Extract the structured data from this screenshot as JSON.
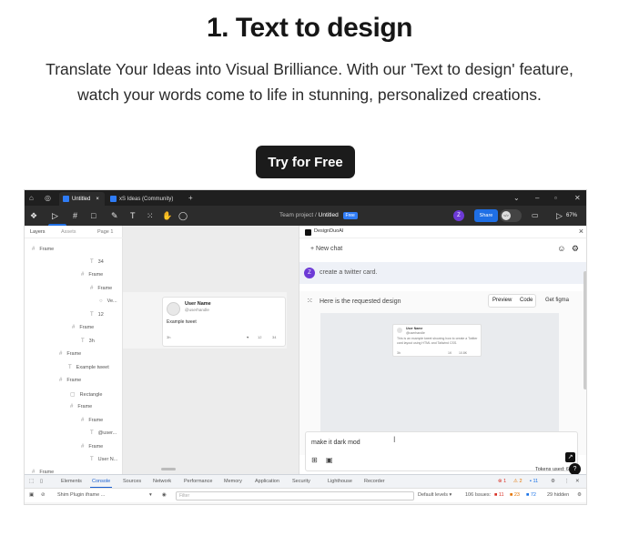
{
  "hero": {
    "title": "1. Text to design",
    "subtitle": "Translate Your Ideas into Visual Brilliance. With our 'Text to design' feature, watch your words come to life in stunning, personalized creations.",
    "cta_label": "Try for Free"
  },
  "browser": {
    "tabs": [
      {
        "label": "Untitled",
        "close": "×"
      },
      {
        "label": "xS Ideas (Community)"
      }
    ],
    "new_tab": "+"
  },
  "figma_toolbar": {
    "project": "Team project",
    "separator": "/",
    "file": "Untitled",
    "badge": "Free",
    "avatar": "Z",
    "share_label": "Share",
    "code_label": "</>",
    "zoom": "67%"
  },
  "layers_panel": {
    "tab_layers": "Layers",
    "tab_assets": "Assets",
    "page": "Page 1",
    "items": [
      {
        "label": "Frame",
        "icon": "#"
      },
      {
        "label": "34",
        "icon": "T"
      },
      {
        "label": "Frame",
        "icon": "#"
      },
      {
        "label": "Frame",
        "icon": "#"
      },
      {
        "label": "Ve...",
        "icon": "○"
      },
      {
        "label": "12",
        "icon": "T"
      },
      {
        "label": "Frame",
        "icon": "#"
      },
      {
        "label": "3h",
        "icon": "T"
      },
      {
        "label": "Frame",
        "icon": "#"
      },
      {
        "label": "Example tweet",
        "icon": "T"
      },
      {
        "label": "Frame",
        "icon": "#"
      },
      {
        "label": "Rectangle",
        "icon": "▢"
      },
      {
        "label": "Frame",
        "icon": "#"
      },
      {
        "label": "Frame",
        "icon": "#"
      },
      {
        "label": "@user...",
        "icon": "T"
      },
      {
        "label": "Frame",
        "icon": "#"
      },
      {
        "label": "User N...",
        "icon": "T"
      },
      {
        "label": "Frame",
        "icon": "#"
      }
    ]
  },
  "canvas": {
    "card": {
      "name": "User Name",
      "handle": "@userhandle",
      "text": "Example tweet",
      "time": "3h",
      "stats": [
        "12",
        "34"
      ]
    }
  },
  "plugin": {
    "name": "DesignDuoAI",
    "new_chat": "+ New chat",
    "user_avatar": "Z",
    "user_message": "create a twitter card.",
    "bot_message": "Here is the requested design",
    "tab_preview": "Preview",
    "tab_code": "Code",
    "get_figma": "Get figma",
    "mini_card": {
      "name": "User Name",
      "handle": "@userhandle",
      "text": "This is an example tweet showing how to create a Twitter card layout using HTML and Tailwind CSS.",
      "time": "3h",
      "stats": [
        "1K",
        "10.8K"
      ]
    },
    "composer_text": "make it dark mod",
    "tokens": "Tokens used: 60%"
  },
  "devtools": {
    "tabs": [
      "Elements",
      "Console",
      "Sources",
      "Network",
      "Performance",
      "Memory",
      "Application",
      "Security",
      "Lighthouse",
      "Recorder"
    ],
    "active_tab": "Console",
    "context": "Shim Plugin iframe ...",
    "filter_placeholder": "Filter",
    "levels": "Default levels ▾",
    "issues_label": "106 Issues:",
    "issues": {
      "errors": "11",
      "warnings": "23",
      "info": "72"
    },
    "hidden": "29 hidden",
    "badges": {
      "errors": "1",
      "warnings": "2",
      "info": "11"
    }
  }
}
